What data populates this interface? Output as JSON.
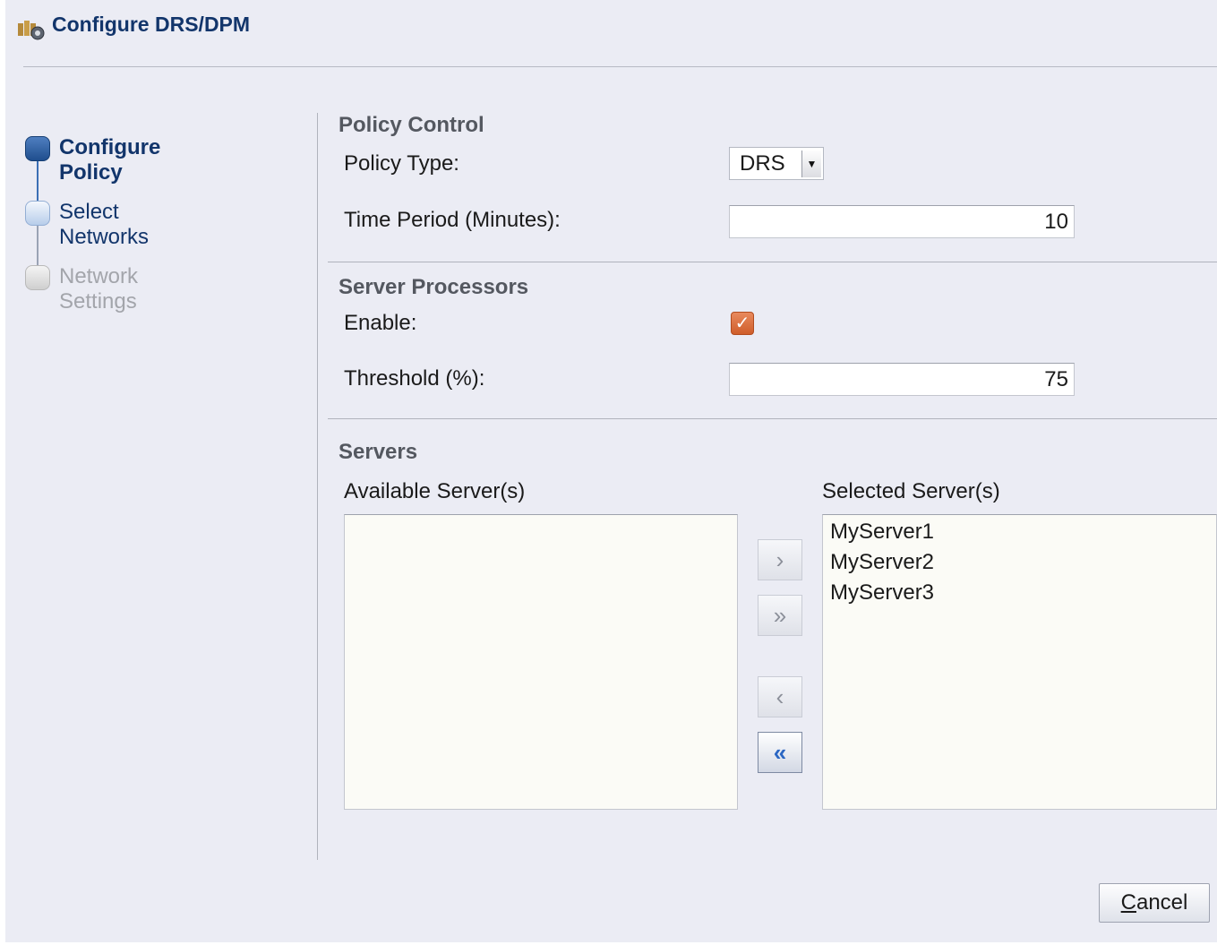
{
  "window": {
    "title": "Configure DRS/DPM",
    "icon": "cluster-settings-icon"
  },
  "steps": [
    {
      "label": "Configure Policy",
      "state": "current"
    },
    {
      "label": "Select Networks",
      "state": "next"
    },
    {
      "label": "Network Settings",
      "state": "disabled"
    }
  ],
  "policy_control": {
    "section_title": "Policy Control",
    "policy_type_label": "Policy Type:",
    "policy_type_value": "DRS",
    "time_period_label": "Time Period (Minutes):",
    "time_period_value": "10"
  },
  "server_processors": {
    "section_title": "Server Processors",
    "enable_label": "Enable:",
    "enable_checked": true,
    "threshold_label": "Threshold (%):",
    "threshold_value": "75"
  },
  "servers": {
    "section_title": "Servers",
    "available_label": "Available Server(s)",
    "available_items": [],
    "selected_label": "Selected Server(s)",
    "selected_items": [
      "MyServer1",
      "MyServer2",
      "MyServer3"
    ],
    "buttons": {
      "move_right": "›",
      "move_all_right": "»",
      "move_left": "‹",
      "move_all_left": "«"
    }
  },
  "footer": {
    "cancel_prefix": "C",
    "cancel_rest": "ancel"
  },
  "colors": {
    "title": "#12356b",
    "checkbox": "#d4652f",
    "dialog_bg": "#ebecf4"
  }
}
